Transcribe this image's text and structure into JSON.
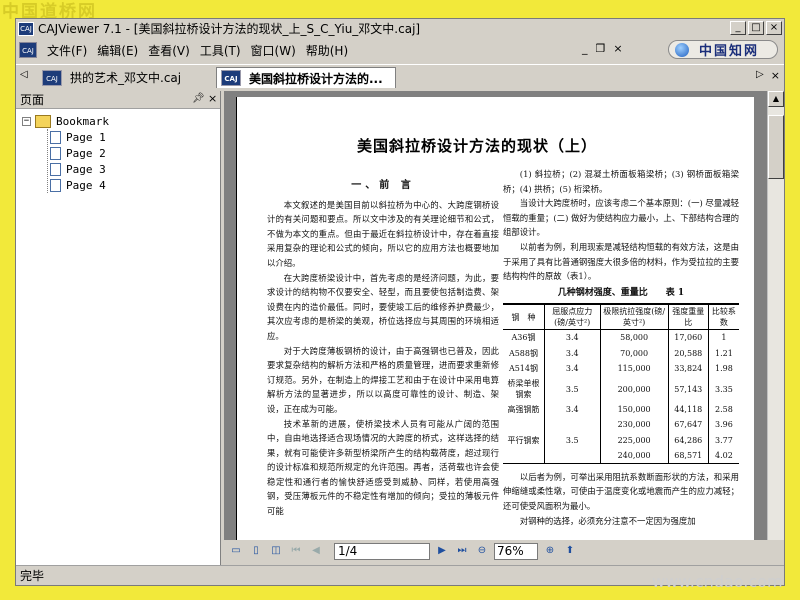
{
  "watermark_top": "中国道桥网",
  "watermark_bottom": "www.cndao.com",
  "window": {
    "title": "CAJViewer 7.1 - [美国斜拉桥设计方法的现状_上_S_C_Yiu_邓文中.caj]",
    "minimize": "_",
    "maximize": "□",
    "close": "×"
  },
  "menu": {
    "items": [
      "文件(F)",
      "编辑(E)",
      "查看(V)",
      "工具(T)",
      "窗口(W)",
      "帮助(H)"
    ],
    "cnki_label": "中国知网"
  },
  "tabs": [
    {
      "label": "拱的艺术_邓文中.caj",
      "active": false
    },
    {
      "label": "美国斜拉桥设计方法的...",
      "active": true
    }
  ],
  "panel": {
    "title": "页面",
    "root": "Bookmark",
    "pages": [
      "Page 1",
      "Page 2",
      "Page 3",
      "Page 4"
    ]
  },
  "document": {
    "title": "美国斜拉桥设计方法的现状（上）",
    "left_section": "一、前 言",
    "left_paragraphs": [
      "本文叙述的是美国目前以斜拉桥为中心的、大跨度钢桥设计的有关问题和要点。所以文中涉及的有关理论细节和公式，不做为本文的重点。但由于最近在斜拉桥设计中，存在着直接采用复杂的理论和公式的倾向，所以它的应用方法也概要地加以介绍。",
      "在大跨度桥梁设计中，首先考虑的是经济问题，为此，要求设计的结构物不仅要安全、轻型，而且要使包括制造费、架设费在内的造价最低。同时，要使竣工后的维修养护费最少，其次应考虑的是桥梁的美观，桥位选择应与其周围的环境相适应。",
      "对于大跨度薄板钢桥的设计，由于高强钢也已普及，因此要求复杂结构的解析方法和严格的质量管理，进而要求重新修订规范。另外，在制造上的焊接工艺和由于在设计中采用电算解析方法的显著进步，所以以高度可靠性的设计、制造、架设，正在成为可能。",
      "技术革新的进展，使桥梁技术人员有可能从广阔的范围中，自由地选择适合现场情况的大跨度的桥式，这样选择的结果，就有可能使许多新型桥梁所产生的结构载荷度，超过现行的设计标准和规范所规定的允许范围。再者，活荷载也许会使稳定性和通行者的愉快舒适感受到威胁、同样，若使用高强钢，受压薄板元件的不稳定性有增加的倾向；受拉的薄板元件可能"
    ],
    "right_paragraphs": [
      "(1) 斜拉桥；(2) 混凝土桥面板箱梁桥；(3) 钢桥面板箱梁桥；(4) 拱桥；(5) 桁梁桥。",
      "当设计大跨度桥时，应该考虑二个基本原则：(一) 尽量减轻恒载的重量；(二) 做好为使结构应力最小，上、下部结构合理的组部设计。",
      "以前者为例，利用现索是减轻结构恒载的有效方法，这是由于采用了具有比普通钢强度大很多倍的材料，作为受拉拉的主要结构构件的原故（表1）。"
    ],
    "table_title": "几种钢材强度、重量比　　表 1",
    "table_headers": [
      "钢　种",
      "屈服点应力(磅/英寸²)",
      "极限抗拉强度(磅/英寸²)",
      "强度重量比",
      "比较系数"
    ],
    "table_rows": [
      [
        "A36钢",
        "3.4",
        "58,000",
        "17,060",
        "1"
      ],
      [
        "A588钢",
        "3.4",
        "70,000",
        "20,588",
        "1.21"
      ],
      [
        "A514钢",
        "3.4",
        "115,000",
        "33,824",
        "1.98"
      ],
      [
        "桥梁单根钢索",
        "3.5",
        "200,000",
        "57,143",
        "3.35"
      ],
      [
        "高强钢筋",
        "3.4",
        "150,000",
        "44,118",
        "2.58"
      ],
      [
        "",
        "",
        "230,000",
        "67,647",
        "3.96"
      ],
      [
        "平行钢索",
        "3.5",
        "225,000",
        "64,286",
        "3.77"
      ],
      [
        "",
        "",
        "240,000",
        "68,571",
        "4.02"
      ]
    ],
    "right_after": [
      "以后者为例，可举出采用阻抗系数断面形状的方法，和采用伸缩缝或柔性墩，可使由于温度变化或地震而产生的应力减轻；还可使受风面积为最小。",
      "对钢种的选择，必须充分注意不一定因为强度加"
    ]
  },
  "navbar": {
    "page_value": "1/4",
    "zoom_value": "76%"
  },
  "status": "完毕"
}
